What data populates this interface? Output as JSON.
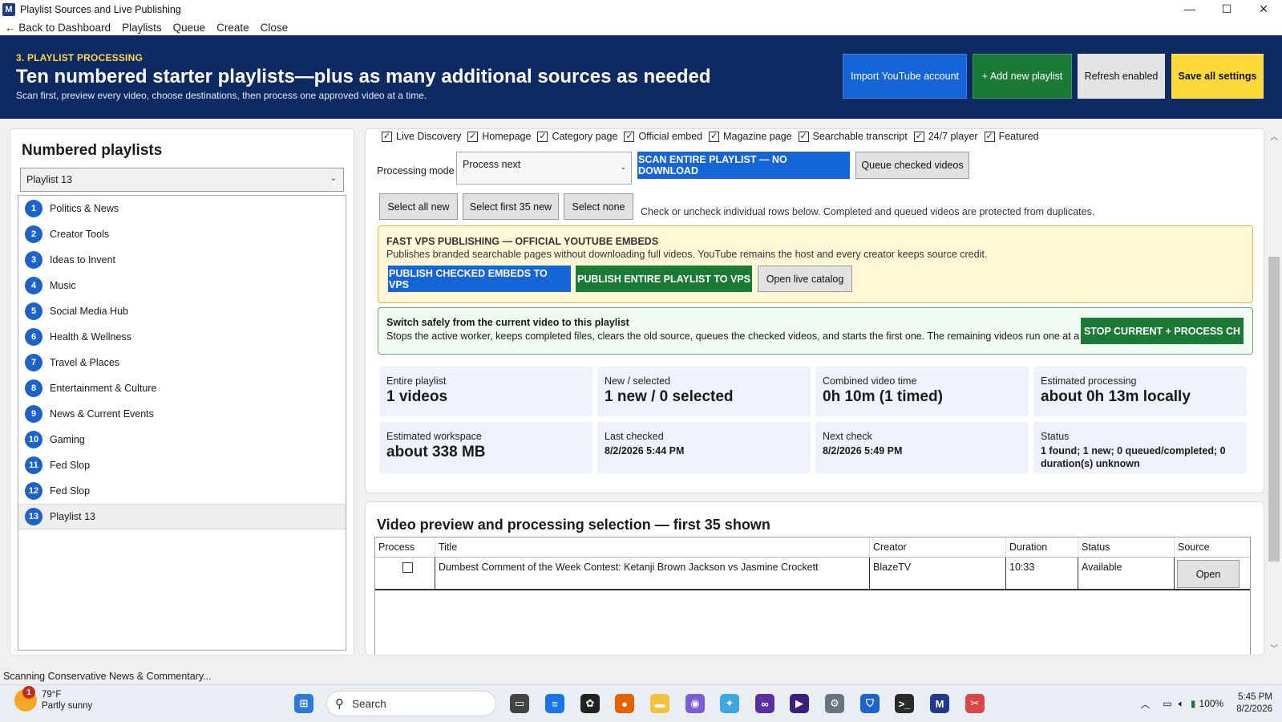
{
  "window": {
    "title": "Playlist Sources and Live Publishing",
    "controls": [
      "—",
      "☐",
      "✕"
    ]
  },
  "menu": {
    "back": "← Back to Dashboard",
    "items": [
      "Playlists",
      "Queue",
      "Create",
      "Close"
    ]
  },
  "banner": {
    "step": "3. PLAYLIST PROCESSING",
    "headline": "Ten numbered starter playlists—plus as many additional sources as needed",
    "sub": "Scan first, preview every video, choose destinations, then process one approved video at a time.",
    "import_label": "Import YouTube account",
    "add_label": "+ Add new playlist",
    "refresh_label": "Refresh enabled",
    "save_label": "Save all settings"
  },
  "sidebar": {
    "title": "Numbered playlists",
    "selected": "Playlist 13",
    "items": [
      {
        "n": "1",
        "label": "Politics & News"
      },
      {
        "n": "2",
        "label": "Creator Tools"
      },
      {
        "n": "3",
        "label": "Ideas to Invent"
      },
      {
        "n": "4",
        "label": "Music"
      },
      {
        "n": "5",
        "label": "Social Media Hub"
      },
      {
        "n": "6",
        "label": "Health & Wellness"
      },
      {
        "n": "7",
        "label": "Travel & Places"
      },
      {
        "n": "8",
        "label": "Entertainment & Culture"
      },
      {
        "n": "9",
        "label": "News & Current Events"
      },
      {
        "n": "10",
        "label": "Gaming"
      },
      {
        "n": "11",
        "label": "Fed Slop"
      },
      {
        "n": "12",
        "label": "Fed Slop"
      },
      {
        "n": "13",
        "label": "Playlist 13"
      }
    ]
  },
  "destinations": [
    {
      "label": "Live Discovery",
      "checked": true
    },
    {
      "label": "Homepage",
      "checked": true
    },
    {
      "label": "Category page",
      "checked": true
    },
    {
      "label": "Official embed",
      "checked": true
    },
    {
      "label": "Magazine page",
      "checked": true
    },
    {
      "label": "Searchable transcript",
      "checked": true
    },
    {
      "label": "24/7 player",
      "checked": true
    },
    {
      "label": "Featured",
      "checked": true
    }
  ],
  "processing": {
    "mode_label": "Processing mode",
    "mode_value": "Process next",
    "scan_label": "SCAN ENTIRE PLAYLIST — NO DOWNLOAD",
    "queue_label": "Queue checked videos",
    "select_all": "Select all new",
    "select_first": "Select first 35 new",
    "select_none": "Select none",
    "hint": "Check or uncheck individual rows below. Completed and queued videos are protected from duplicates."
  },
  "vps": {
    "title": "FAST VPS PUBLISHING — OFFICIAL YOUTUBE EMBEDS",
    "desc": "Publishes branded searchable pages without downloading full videos. YouTube remains the host and every creator keeps source credit.",
    "publish_checked": "PUBLISH CHECKED EMBEDS TO VPS",
    "publish_all": "PUBLISH ENTIRE PLAYLIST TO VPS",
    "open_catalog": "Open live catalog"
  },
  "switch": {
    "title": "Switch safely from the current video to this playlist",
    "desc": "Stops the active worker, keeps completed files, clears the old source, queues the checked videos, and starts the first one. The remaining videos run one at a time.",
    "button": "STOP CURRENT + PROCESS CH"
  },
  "stats": {
    "entire_label": "Entire playlist",
    "entire_value": "1 videos",
    "new_label": "New / selected",
    "new_value": "1 new / 0 selected",
    "combined_label": "Combined video time",
    "combined_value": "0h 10m (1 timed)",
    "est_label": "Estimated processing",
    "est_value": "about 0h 13m locally",
    "workspace_label": "Estimated workspace",
    "workspace_value": "about 338 MB",
    "last_label": "Last checked",
    "last_value": "8/2/2026 5:44 PM",
    "next_label": "Next check",
    "next_value": "8/2/2026 5:49 PM",
    "status_label": "Status",
    "status_value": "1 found; 1 new; 0 queued/completed; 0 duration(s) unknown"
  },
  "preview": {
    "title": "Video preview and processing selection — first 35 shown",
    "columns": {
      "process": "Process",
      "title": "Title",
      "creator": "Creator",
      "duration": "Duration",
      "status": "Status",
      "source": "Source"
    },
    "rows": [
      {
        "title": "Dumbest Comment of the Week Contest: Ketanji Brown Jackson vs Jasmine Crockett",
        "creator": "BlazeTV",
        "duration": "10:33",
        "status": "Available",
        "source_btn": "Open",
        "checked": false
      }
    ]
  },
  "statusbar": {
    "text": "Scanning Conservative News & Commentary..."
  },
  "taskbar": {
    "temp": "79°F",
    "weather": "Partly sunny",
    "notif": "1",
    "search": "Search",
    "battery": "100%",
    "time": "5:45 PM",
    "date": "8/2/2026"
  }
}
